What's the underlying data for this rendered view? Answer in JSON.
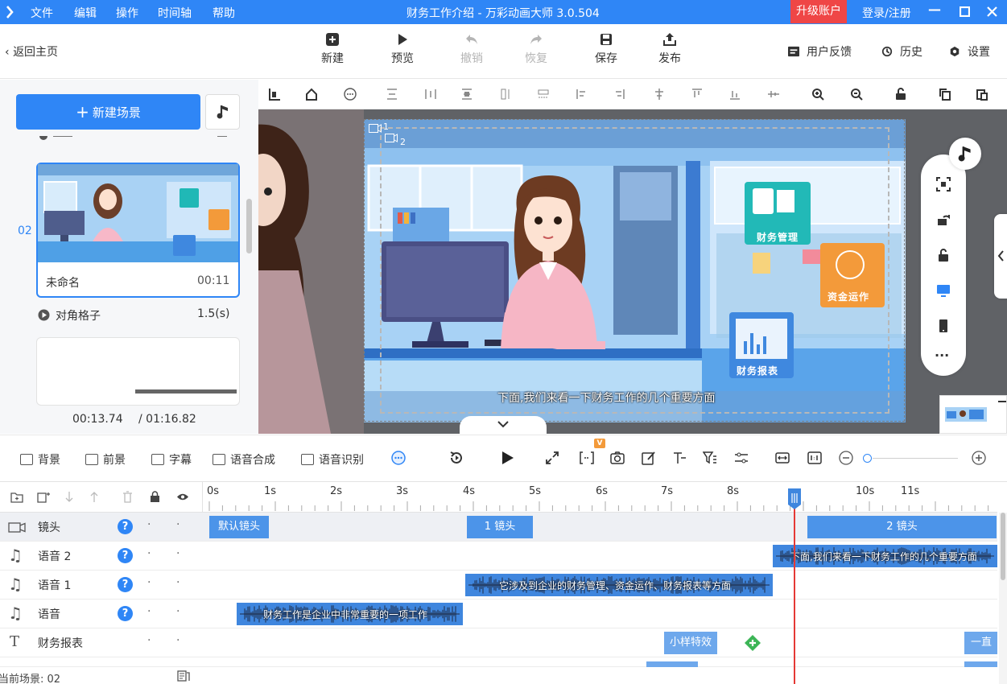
{
  "titlebar": {
    "menu": [
      "文件",
      "编辑",
      "操作",
      "时间轴",
      "帮助"
    ],
    "title": "财务工作介绍 - 万彩动画大师 3.0.504",
    "upgrade": "升级账户",
    "login": "登录/注册"
  },
  "toolbar": {
    "back": "返回主页",
    "new": "新建",
    "preview": "预览",
    "undo": "撤销",
    "redo": "恢复",
    "save": "保存",
    "publish": "发布",
    "feedback": "用户反馈",
    "history": "历史",
    "settings": "设置"
  },
  "leftpanel": {
    "new_scene": "新建场景",
    "scene_number": "02",
    "scene_name": "未命名",
    "scene_duration": "00:11",
    "transition_name": "对角格子",
    "transition_duration": "1.5(s)",
    "current_time": "00:13.74",
    "total_time": "/ 01:16.82"
  },
  "stage": {
    "subtitle": "下面,我们来看一下财务工作的几个重要方面",
    "camera1": "1",
    "camera2": "2",
    "icon1_label": "财务管理",
    "icon2_label": "资金运作",
    "icon3_label": "财务报表"
  },
  "timeline_toolbar": {
    "background": "背景",
    "foreground": "前景",
    "caption": "字幕",
    "tts": "语音合成",
    "asr": "语音识别",
    "badge": "V"
  },
  "ruler": {
    "labels": [
      "0s",
      "1s",
      "2s",
      "3s",
      "4s",
      "5s",
      "6s",
      "7s",
      "8s",
      "10s",
      "11s"
    ]
  },
  "tracks": [
    {
      "name": "镜头"
    },
    {
      "name": "语音 2"
    },
    {
      "name": "语音 1"
    },
    {
      "name": "语音"
    },
    {
      "name": "财务报表"
    }
  ],
  "clips": {
    "camera_default": "默认镜头",
    "camera_1": "1 镜头",
    "camera_2": "2 镜头",
    "voice2": "下面,我们来看一下财务工作的几个重要方面",
    "voice1": "它涉及到企业的财务管理、资金运作、财务报表等方面",
    "voice0": "财务工作是企业中非常重要的一项工作",
    "effect": "小样特效",
    "straight": "一直"
  },
  "status": {
    "current_scene": "当前场景: 02"
  },
  "colors": {
    "accent": "#2f86f6",
    "upgrade": "#ef4646",
    "clip": "#4c94e9",
    "playhead": "#e53935"
  }
}
